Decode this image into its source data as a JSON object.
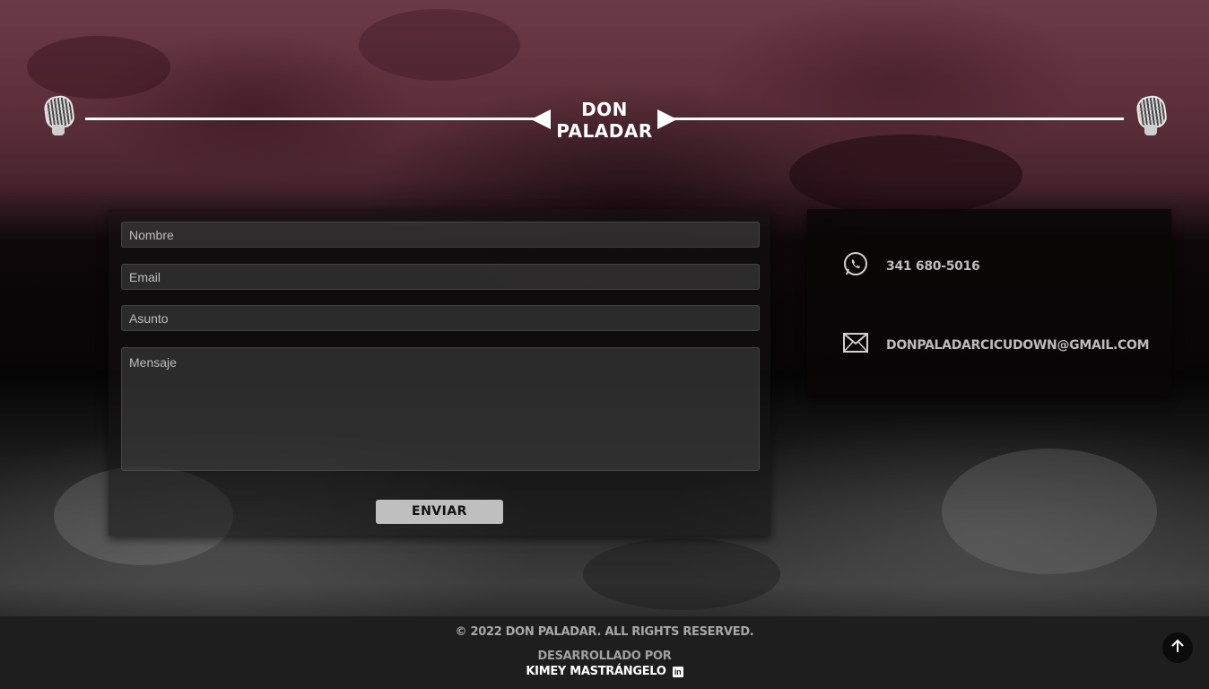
{
  "header": {
    "logo_line1": "DON",
    "logo_line2": "PALADAR"
  },
  "form": {
    "name_placeholder": "Nombre",
    "email_placeholder": "Email",
    "subject_placeholder": "Asunto",
    "message_placeholder": "Mensaje",
    "submit_label": "ENVIAR"
  },
  "contact": {
    "phone": "341 680-5016",
    "email": "DONPALADARCICUDOWN@GMAIL.COM"
  },
  "footer": {
    "copyright": "© 2022 DON PALADAR. ALL RIGHTS RESERVED.",
    "developed_by": "DESARROLLADO POR",
    "author": "KIMEY MASTRÁNGELO",
    "linkedin_glyph": "in"
  }
}
